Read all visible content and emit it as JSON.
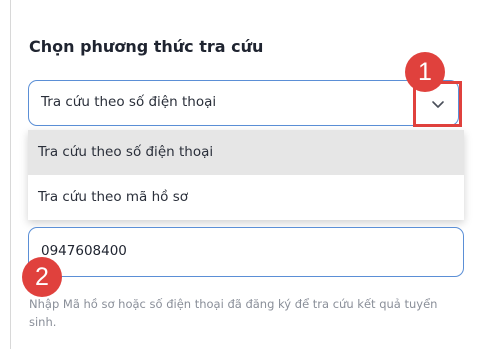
{
  "section_title": "Chọn phương thức tra cứu",
  "select": {
    "selected_value": "Tra cứu theo số điện thoại",
    "icon": "chevron-down-icon"
  },
  "dropdown": {
    "options": [
      {
        "label": "Tra cứu theo số điện thoại",
        "highlighted": true
      },
      {
        "label": "Tra cứu theo mã hồ sơ",
        "highlighted": false
      }
    ]
  },
  "lookup_input": {
    "value": "0947608400"
  },
  "helper_text": "Nhập Mã hồ sơ hoặc số điện thoại đã đăng ký để tra cứu kết quả tuyển sinh.",
  "annotations": {
    "badge_1": "1",
    "badge_2": "2"
  },
  "colors": {
    "accent_border": "#5b8fd6",
    "annotation_red": "#e0413d",
    "highlight_bg": "#e6e6e6"
  }
}
